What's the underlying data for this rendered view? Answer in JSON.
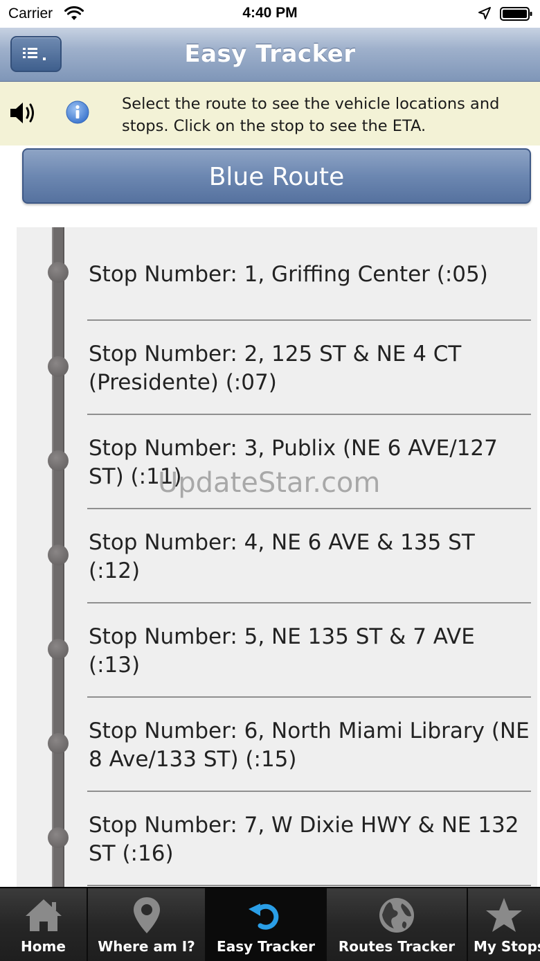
{
  "status_bar": {
    "carrier": "Carrier",
    "time": "4:40 PM"
  },
  "navbar": {
    "title": "Easy Tracker",
    "menu_icon": "list-icon"
  },
  "info": {
    "text": "Select the route to see the vehicle locations and stops. Click on the stop to see the ETA.",
    "speaker_icon": "speaker-icon",
    "info_icon": "info-icon"
  },
  "route": {
    "label": "Blue Route"
  },
  "stops": [
    {
      "text": "Stop Number: 1, Griffing Center (:05)"
    },
    {
      "text": "Stop Number: 2, 125 ST & NE 4 CT (Presidente) (:07)"
    },
    {
      "text": "Stop Number: 3, Publix (NE 6 AVE/127 ST) (:11)"
    },
    {
      "text": "Stop Number: 4, NE 6 AVE & 135 ST (:12)"
    },
    {
      "text": "Stop Number: 5, NE 135 ST & 7 AVE (:13)"
    },
    {
      "text": "Stop Number: 6, North Miami Library (NE 8 Ave/133 ST) (:15)"
    },
    {
      "text": "Stop Number: 7, W Dixie HWY & NE 132 ST (:16)"
    }
  ],
  "watermark": "UpdateStar.com",
  "tabs": [
    {
      "label": "Home",
      "icon": "home-icon"
    },
    {
      "label": "Where am I?",
      "icon": "map-pin-icon"
    },
    {
      "label": "Easy Tracker",
      "icon": "refresh-icon",
      "active": true
    },
    {
      "label": "Routes Tracker",
      "icon": "globe-icon"
    },
    {
      "label": "My Stops",
      "icon": "star-icon"
    }
  ],
  "colors": {
    "accent_blue": "#2a9ee6",
    "nav_blue": "#7f96b8",
    "info_bg": "#f3f2d6"
  }
}
